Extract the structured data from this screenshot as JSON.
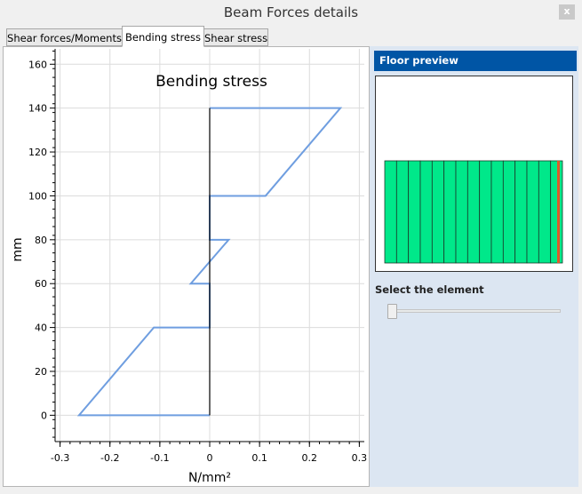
{
  "window": {
    "title": "Beam Forces details",
    "close_label": "x"
  },
  "tabs": [
    {
      "label": "Shear forces/Moments",
      "active": false
    },
    {
      "label": "Bending stress",
      "active": true
    },
    {
      "label": "Shear stress",
      "active": false
    }
  ],
  "right_panel": {
    "preview_title": "Floor preview",
    "select_label": "Select the element",
    "slider_value": 0,
    "floor_colors": {
      "fill": "#00e88a",
      "highlight": "#e05a2a"
    },
    "element_count": 15
  },
  "chart_data": {
    "type": "line",
    "title": "Bending stress",
    "xlabel": "N/mm²",
    "ylabel": "mm",
    "xlim": [
      -0.31,
      0.31
    ],
    "ylim": [
      -12,
      167
    ],
    "grid": true,
    "x_ticks": [
      "-0.3",
      "-0.2",
      "-0.1",
      "0",
      "0.1",
      "0.2",
      "0.3"
    ],
    "y_ticks": [
      "0",
      "20",
      "40",
      "60",
      "80",
      "100",
      "120",
      "140",
      "160"
    ],
    "series": [
      {
        "color": "#6f9ee0",
        "points": [
          [
            0,
            0
          ],
          [
            -0.262,
            0
          ],
          [
            -0.112,
            40
          ],
          [
            0,
            40
          ],
          [
            0,
            60
          ],
          [
            -0.038,
            60
          ],
          [
            0.038,
            80
          ],
          [
            0,
            80
          ],
          [
            0,
            100
          ],
          [
            0.112,
            100
          ],
          [
            0.262,
            140
          ],
          [
            0,
            140
          ]
        ]
      },
      {
        "color": "#000000",
        "points": [
          [
            0,
            0
          ],
          [
            0,
            140
          ]
        ]
      }
    ]
  }
}
